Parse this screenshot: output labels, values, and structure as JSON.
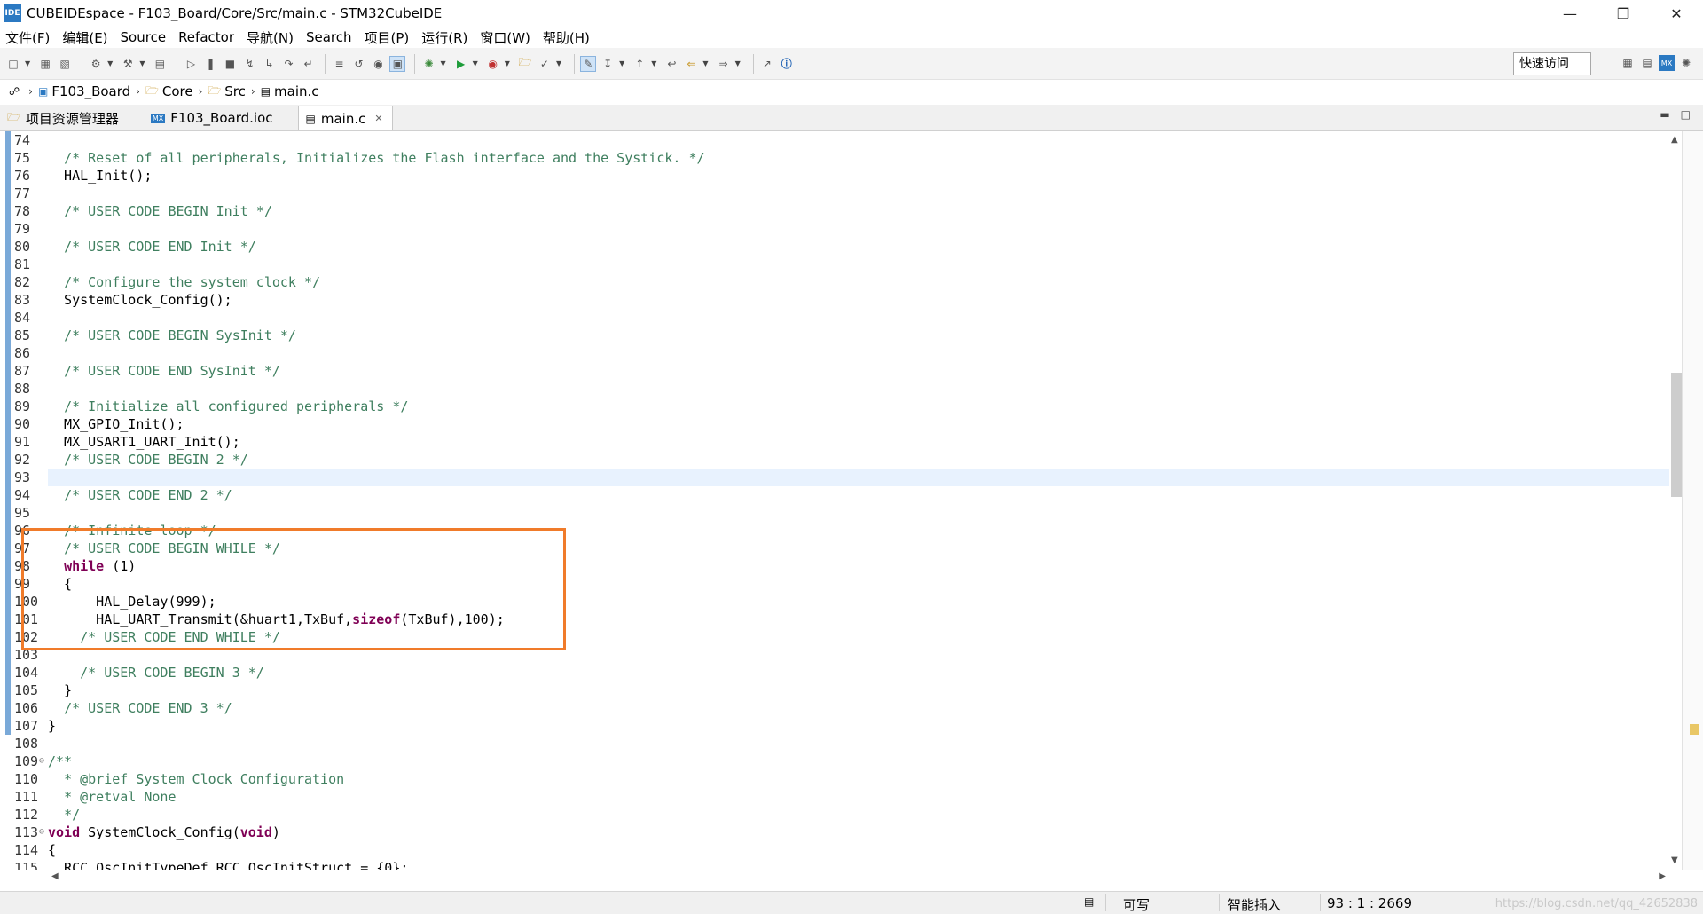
{
  "window": {
    "icon_text": "IDE",
    "title": "CUBEIDEspace - F103_Board/Core/Src/main.c - STM32CubeIDE",
    "minimize": "—",
    "maximize": "❐",
    "close": "✕"
  },
  "menu": [
    "文件(F)",
    "编辑(E)",
    "Source",
    "Refactor",
    "导航(N)",
    "Search",
    "项目(P)",
    "运行(R)",
    "窗口(W)",
    "帮助(H)"
  ],
  "toolbar": {
    "quick_access": "快速访问"
  },
  "breadcrumb": {
    "items": [
      "F103_Board",
      "Core",
      "Src",
      "main.c"
    ]
  },
  "tabs": [
    {
      "label": "项目资源管理器",
      "active": false
    },
    {
      "label": "F103_Board.ioc",
      "active": false
    },
    {
      "label": "main.c",
      "active": true
    }
  ],
  "editor": {
    "current_line": 93,
    "lines": [
      {
        "n": "74",
        "text": ""
      },
      {
        "n": "75",
        "text": "  /* Reset of all peripherals, Initializes the Flash interface and the Systick. */"
      },
      {
        "n": "76",
        "text": "  HAL_Init();"
      },
      {
        "n": "77",
        "text": ""
      },
      {
        "n": "78",
        "text": "  /* USER CODE BEGIN Init */"
      },
      {
        "n": "79",
        "text": ""
      },
      {
        "n": "80",
        "text": "  /* USER CODE END Init */"
      },
      {
        "n": "81",
        "text": ""
      },
      {
        "n": "82",
        "text": "  /* Configure the system clock */"
      },
      {
        "n": "83",
        "text": "  SystemClock_Config();"
      },
      {
        "n": "84",
        "text": ""
      },
      {
        "n": "85",
        "text": "  /* USER CODE BEGIN SysInit */"
      },
      {
        "n": "86",
        "text": ""
      },
      {
        "n": "87",
        "text": "  /* USER CODE END SysInit */"
      },
      {
        "n": "88",
        "text": ""
      },
      {
        "n": "89",
        "text": "  /* Initialize all configured peripherals */"
      },
      {
        "n": "90",
        "text": "  MX_GPIO_Init();"
      },
      {
        "n": "91",
        "text": "  MX_USART1_UART_Init();"
      },
      {
        "n": "92",
        "text": "  /* USER CODE BEGIN 2 */"
      },
      {
        "n": "93",
        "text": ""
      },
      {
        "n": "94",
        "text": "  /* USER CODE END 2 */"
      },
      {
        "n": "95",
        "text": ""
      },
      {
        "n": "96",
        "text": "  /* Infinite loop */"
      },
      {
        "n": "97",
        "text": "  /* USER CODE BEGIN WHILE */"
      },
      {
        "n": "98",
        "text": "  while (1)"
      },
      {
        "n": "99",
        "text": "  {"
      },
      {
        "n": "100",
        "text": "      HAL_Delay(999);"
      },
      {
        "n": "101",
        "text": "      HAL_UART_Transmit(&huart1,TxBuf,sizeof(TxBuf),100);"
      },
      {
        "n": "102",
        "text": "    /* USER CODE END WHILE */"
      },
      {
        "n": "103",
        "text": ""
      },
      {
        "n": "104",
        "text": "    /* USER CODE BEGIN 3 */"
      },
      {
        "n": "105",
        "text": "  }"
      },
      {
        "n": "106",
        "text": "  /* USER CODE END 3 */"
      },
      {
        "n": "107",
        "text": "}"
      },
      {
        "n": "108",
        "text": ""
      },
      {
        "n": "109",
        "text": "/**",
        "fold": true
      },
      {
        "n": "110",
        "text": "  * @brief System Clock Configuration"
      },
      {
        "n": "111",
        "text": "  * @retval None"
      },
      {
        "n": "112",
        "text": "  */"
      },
      {
        "n": "113",
        "text": "void SystemClock_Config(void)",
        "fold": true
      },
      {
        "n": "114",
        "text": "{"
      },
      {
        "n": "115",
        "text": "  RCC_OscInitTypeDef RCC_OscInitStruct = {0};"
      }
    ]
  },
  "statusbar": {
    "writable": "可写",
    "insert_mode": "智能插入",
    "position": "93 : 1 : 2669",
    "watermark": "https://blog.csdn.net/qq_42652838"
  }
}
